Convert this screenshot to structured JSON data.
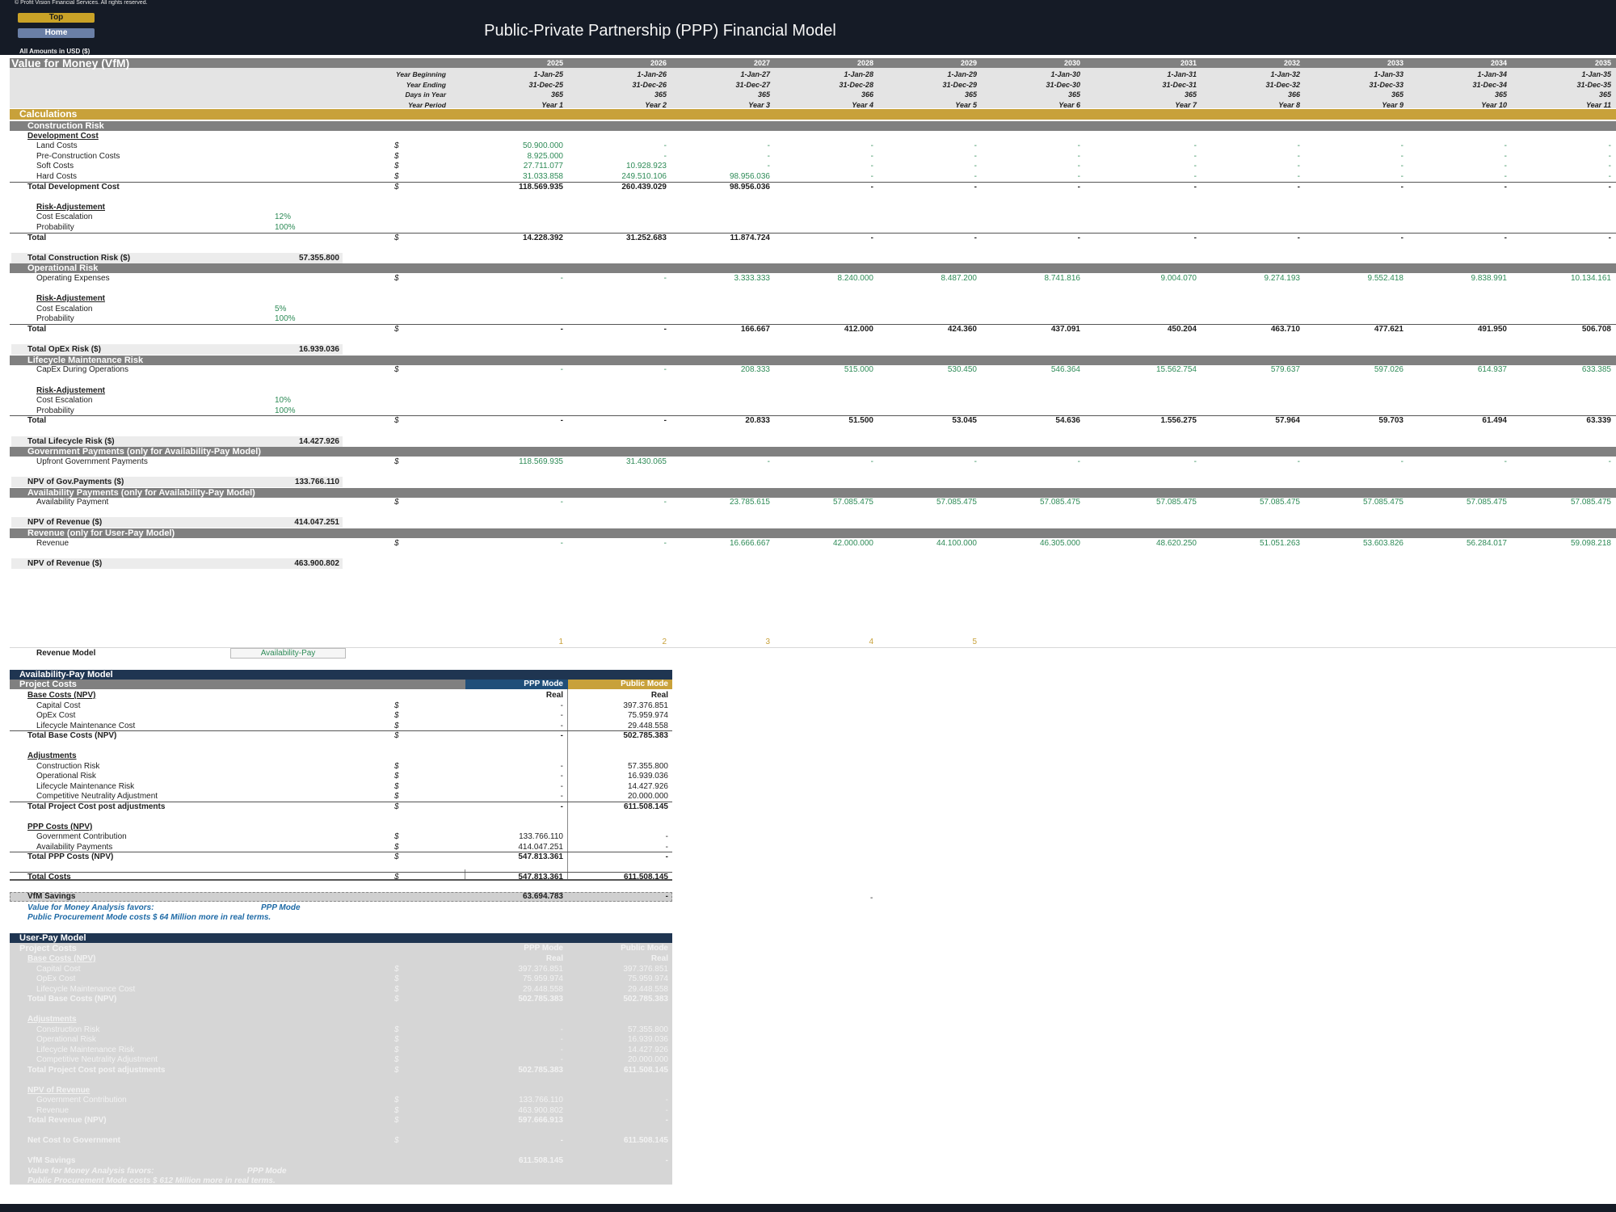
{
  "header": {
    "copyright": "© Profit Vision Financial Services. All rights reserved.",
    "title": "Public-Private Partnership (PPP) Financial Model",
    "top_button": "Top",
    "home_button": "Home",
    "amounts_note": "All Amounts in  USD ($)"
  },
  "colors": {
    "header_bg": "#151b26",
    "band_gray": "#808080",
    "gold": "#c8a13a",
    "navy": "#1f3551",
    "ppp_blue": "#1f4e79",
    "green": "#2e8b57"
  },
  "section_title": "Value for Money (VfM)",
  "year_labels": {
    "beginning": "Year Beginning",
    "ending": "Year Ending",
    "days": "Days in Year",
    "period": "Year Period"
  },
  "years": [
    {
      "year": "2025",
      "begin": "1-Jan-25",
      "end": "31-Dec-25",
      "days": "365",
      "period": "Year 1"
    },
    {
      "year": "2026",
      "begin": "1-Jan-26",
      "end": "31-Dec-26",
      "days": "365",
      "period": "Year 2"
    },
    {
      "year": "2027",
      "begin": "1-Jan-27",
      "end": "31-Dec-27",
      "days": "365",
      "period": "Year 3"
    },
    {
      "year": "2028",
      "begin": "1-Jan-28",
      "end": "31-Dec-28",
      "days": "366",
      "period": "Year 4"
    },
    {
      "year": "2029",
      "begin": "1-Jan-29",
      "end": "31-Dec-29",
      "days": "365",
      "period": "Year 5"
    },
    {
      "year": "2030",
      "begin": "1-Jan-30",
      "end": "31-Dec-30",
      "days": "365",
      "period": "Year 6"
    },
    {
      "year": "2031",
      "begin": "1-Jan-31",
      "end": "31-Dec-31",
      "days": "365",
      "period": "Year 7"
    },
    {
      "year": "2032",
      "begin": "1-Jan-32",
      "end": "31-Dec-32",
      "days": "366",
      "period": "Year 8"
    },
    {
      "year": "2033",
      "begin": "1-Jan-33",
      "end": "31-Dec-33",
      "days": "365",
      "period": "Year 9"
    },
    {
      "year": "2034",
      "begin": "1-Jan-34",
      "end": "31-Dec-34",
      "days": "365",
      "period": "Year 10"
    },
    {
      "year": "2035",
      "begin": "1-Jan-35",
      "end": "31-Dec-35",
      "days": "365",
      "period": "Year 11"
    }
  ],
  "calc_title": "Calculations",
  "blocks": [
    {
      "band": "Construction Risk",
      "rows": [
        {
          "label": "Development Cost",
          "type": "subheader"
        },
        {
          "label": "Land Costs",
          "cur": "$",
          "values": [
            "50.900.000",
            "-",
            "-",
            "-",
            "-",
            "-",
            "-",
            "-",
            "-",
            "-",
            "-"
          ],
          "style": "input"
        },
        {
          "label": "Pre-Construction Costs",
          "cur": "$",
          "values": [
            "8.925.000",
            "-",
            "-",
            "-",
            "-",
            "-",
            "-",
            "-",
            "-",
            "-",
            "-"
          ],
          "style": "input"
        },
        {
          "label": "Soft Costs",
          "cur": "$",
          "values": [
            "27.711.077",
            "10.928.923",
            "-",
            "-",
            "-",
            "-",
            "-",
            "-",
            "-",
            "-",
            "-"
          ],
          "style": "input"
        },
        {
          "label": "Hard Costs",
          "cur": "$",
          "values": [
            "31.033.858",
            "249.510.106",
            "98.956.036",
            "-",
            "-",
            "-",
            "-",
            "-",
            "-",
            "-",
            "-"
          ],
          "style": "input"
        },
        {
          "label": "Total Development Cost",
          "cur": "$",
          "values": [
            "118.569.935",
            "260.439.029",
            "98.956.036",
            "-",
            "-",
            "-",
            "-",
            "-",
            "-",
            "-",
            "-"
          ],
          "style": "total"
        },
        {
          "type": "blank"
        },
        {
          "label": "Risk-Adjustement",
          "type": "subheader2"
        },
        {
          "label": "Cost Escalation",
          "type": "param",
          "value": "12%"
        },
        {
          "label": "Probability",
          "type": "param",
          "value": "100%"
        },
        {
          "label": "Total",
          "cur": "$",
          "values": [
            "14.228.392",
            "31.252.683",
            "11.874.724",
            "-",
            "-",
            "-",
            "-",
            "-",
            "-",
            "-",
            "-"
          ],
          "style": "total"
        },
        {
          "type": "blank"
        },
        {
          "label": "Total Construction Risk  ($)",
          "type": "summary",
          "value": "57.355.800"
        }
      ]
    },
    {
      "band": "Operational Risk",
      "rows": [
        {
          "label": "Operating Expenses",
          "cur": "$",
          "values": [
            "-",
            "-",
            "3.333.333",
            "8.240.000",
            "8.487.200",
            "8.741.816",
            "9.004.070",
            "9.274.193",
            "9.552.418",
            "9.838.991",
            "10.134.161"
          ],
          "style": "input"
        },
        {
          "type": "blank"
        },
        {
          "label": "Risk-Adjustement",
          "type": "subheader2"
        },
        {
          "label": "Cost Escalation",
          "type": "param",
          "value": "5%"
        },
        {
          "label": "Probability",
          "type": "param",
          "value": "100%"
        },
        {
          "label": "Total",
          "cur": "$",
          "values": [
            "-",
            "-",
            "166.667",
            "412.000",
            "424.360",
            "437.091",
            "450.204",
            "463.710",
            "477.621",
            "491.950",
            "506.708"
          ],
          "style": "total"
        },
        {
          "type": "blank"
        },
        {
          "label": "Total OpEx Risk  ($)",
          "type": "summary",
          "value": "16.939.036"
        }
      ]
    },
    {
      "band": "Lifecycle Maintenance Risk",
      "rows": [
        {
          "label": "CapEx During Operations",
          "cur": "$",
          "values": [
            "-",
            "-",
            "208.333",
            "515.000",
            "530.450",
            "546.364",
            "15.562.754",
            "579.637",
            "597.026",
            "614.937",
            "633.385"
          ],
          "style": "input"
        },
        {
          "type": "blank"
        },
        {
          "label": "Risk-Adjustement",
          "type": "subheader2"
        },
        {
          "label": "Cost Escalation",
          "type": "param",
          "value": "10%"
        },
        {
          "label": "Probability",
          "type": "param",
          "value": "100%"
        },
        {
          "label": "Total",
          "cur": "$",
          "values": [
            "-",
            "-",
            "20.833",
            "51.500",
            "53.045",
            "54.636",
            "1.556.275",
            "57.964",
            "59.703",
            "61.494",
            "63.339"
          ],
          "style": "total"
        },
        {
          "type": "blank"
        },
        {
          "label": "Total Lifecycle Risk  ($)",
          "type": "summary",
          "value": "14.427.926"
        }
      ]
    },
    {
      "band": "Government Payments (only for Availability-Pay Model)",
      "rows": [
        {
          "label": "Upfront Government Payments",
          "cur": "$",
          "values": [
            "118.569.935",
            "31.430.065",
            "-",
            "-",
            "-",
            "-",
            "-",
            "-",
            "-",
            "-",
            "-"
          ],
          "style": "input"
        },
        {
          "type": "blank"
        },
        {
          "label": "NPV of Gov.Payments  ($)",
          "type": "summary",
          "value": "133.766.110"
        }
      ]
    },
    {
      "band": "Availability Payments (only for Availability-Pay Model)",
      "rows": [
        {
          "label": "Availability Payment",
          "cur": "$",
          "values": [
            "-",
            "-",
            "23.785.615",
            "57.085.475",
            "57.085.475",
            "57.085.475",
            "57.085.475",
            "57.085.475",
            "57.085.475",
            "57.085.475",
            "57.085.475"
          ],
          "style": "input"
        },
        {
          "type": "blank"
        },
        {
          "label": "NPV of Revenue  ($)",
          "type": "summary",
          "value": "414.047.251"
        }
      ]
    },
    {
      "band": "Revenue (only for User-Pay Model)",
      "rows": [
        {
          "label": "Revenue",
          "cur": "$",
          "values": [
            "-",
            "-",
            "16.666.667",
            "42.000.000",
            "44.100.000",
            "46.305.000",
            "48.620.250",
            "51.051.263",
            "53.603.826",
            "56.284.017",
            "59.098.218"
          ],
          "style": "input"
        },
        {
          "type": "blank"
        },
        {
          "label": "NPV of Revenue  ($)",
          "type": "summary",
          "value": "463.900.802"
        }
      ]
    }
  ],
  "model_selector": {
    "numbers": [
      "1",
      "2",
      "3",
      "4",
      "5"
    ],
    "label": "Revenue Model",
    "value": "Availability-Pay"
  },
  "availability_model": {
    "title": "Availability-Pay Model",
    "header": {
      "label": "Project Costs",
      "ppp": "PPP Mode",
      "public": "Public Mode"
    },
    "rows": [
      {
        "label": "Base Costs (NPV)",
        "ppp": "Real",
        "pub": "Real",
        "style": "subheader"
      },
      {
        "label": "Capital Cost",
        "cur": "$",
        "ppp": "-",
        "pub": "397.376.851"
      },
      {
        "label": "OpEx Cost",
        "cur": "$",
        "ppp": "-",
        "pub": "75.959.974"
      },
      {
        "label": "Lifecycle Maintenance Cost",
        "cur": "$",
        "ppp": "-",
        "pub": "29.448.558"
      },
      {
        "label": "Total Base Costs (NPV)",
        "cur": "$",
        "ppp": "-",
        "pub": "502.785.383",
        "style": "total"
      },
      {
        "style": "blank"
      },
      {
        "label": "Adjustments",
        "style": "subheader"
      },
      {
        "label": "Construction Risk",
        "cur": "$",
        "ppp": "-",
        "pub": "57.355.800"
      },
      {
        "label": "Operational Risk",
        "cur": "$",
        "ppp": "-",
        "pub": "16.939.036"
      },
      {
        "label": "Lifecycle Maintenance Risk",
        "cur": "$",
        "ppp": "-",
        "pub": "14.427.926"
      },
      {
        "label": "Competitive Neutrality Adjustment",
        "cur": "$",
        "ppp": "-",
        "pub": "20.000.000"
      },
      {
        "label": "Total Project Cost post adjustments",
        "cur": "$",
        "ppp": "-",
        "pub": "611.508.145",
        "style": "total"
      },
      {
        "style": "blank"
      },
      {
        "label": "PPP Costs (NPV)",
        "style": "subheader"
      },
      {
        "label": "Government Contribution",
        "cur": "$",
        "ppp": "133.766.110",
        "pub": "-"
      },
      {
        "label": "Availability Payments",
        "cur": "$",
        "ppp": "414.047.251",
        "pub": "-"
      },
      {
        "label": "Total PPP Costs (NPV)",
        "cur": "$",
        "ppp": "547.813.361",
        "pub": "-",
        "style": "total"
      },
      {
        "style": "blank"
      },
      {
        "label": "Total Costs",
        "cur": "$",
        "ppp": "547.813.361",
        "pub": "611.508.145",
        "style": "grand"
      }
    ],
    "vfm": {
      "label": "VfM Savings",
      "ppp": "63.694.783",
      "pub": "-",
      "stray": "-"
    },
    "favors_label": "Value for Money Analysis favors:",
    "favors_value": "PPP Mode",
    "note": "Public Procurement Mode costs $ 64 Million more in real terms."
  },
  "user_pay_model": {
    "title": "User-Pay Model",
    "header": {
      "label": "Project Costs",
      "ppp": "PPP Mode",
      "public": "Public Mode"
    },
    "rows": [
      {
        "label": "Base Costs (NPV)",
        "ppp": "Real",
        "pub": "Real",
        "style": "subheader"
      },
      {
        "label": "Capital Cost",
        "cur": "$",
        "ppp": "397.376.851",
        "pub": "397.376.851"
      },
      {
        "label": "OpEx Cost",
        "cur": "$",
        "ppp": "75.959.974",
        "pub": "75.959.974"
      },
      {
        "label": "Lifecycle Maintenance Cost",
        "cur": "$",
        "ppp": "29.448.558",
        "pub": "29.448.558"
      },
      {
        "label": "Total Base Costs (NPV)",
        "cur": "$",
        "ppp": "502.785.383",
        "pub": "502.785.383",
        "style": "total"
      },
      {
        "style": "blank"
      },
      {
        "label": "Adjustments",
        "style": "subheader"
      },
      {
        "label": "Construction Risk",
        "cur": "$",
        "ppp": "-",
        "pub": "57.355.800"
      },
      {
        "label": "Operational Risk",
        "cur": "$",
        "ppp": "-",
        "pub": "16.939.036"
      },
      {
        "label": "Lifecycle Maintenance Risk",
        "cur": "$",
        "ppp": "-",
        "pub": "14.427.926"
      },
      {
        "label": "Competitive Neutrality Adjustment",
        "cur": "$",
        "ppp": "-",
        "pub": "20.000.000"
      },
      {
        "label": "Total Project Cost post adjustments",
        "cur": "$",
        "ppp": "502.785.383",
        "pub": "611.508.145",
        "style": "total"
      },
      {
        "style": "blank"
      },
      {
        "label": "NPV of Revenue",
        "style": "subheader"
      },
      {
        "label": "Government Contribution",
        "cur": "$",
        "ppp": "133.766.110",
        "pub": "-"
      },
      {
        "label": "Revenue",
        "cur": "$",
        "ppp": "463.900.802",
        "pub": "-"
      },
      {
        "label": "Total Revenue (NPV)",
        "cur": "$",
        "ppp": "597.666.913",
        "pub": "-",
        "style": "total"
      },
      {
        "style": "blank"
      },
      {
        "label": "Net Cost to Government",
        "cur": "$",
        "ppp": "-",
        "pub": "611.508.145",
        "style": "total"
      },
      {
        "style": "blank"
      },
      {
        "label": "VfM Savings",
        "ppp": "611.508.145",
        "pub": "-",
        "style": "total"
      }
    ],
    "favors_label": "Value for Money Analysis favors:",
    "favors_value": "PPP Mode",
    "note": "Public Procurement Mode costs $ 612 Million more in real terms."
  }
}
